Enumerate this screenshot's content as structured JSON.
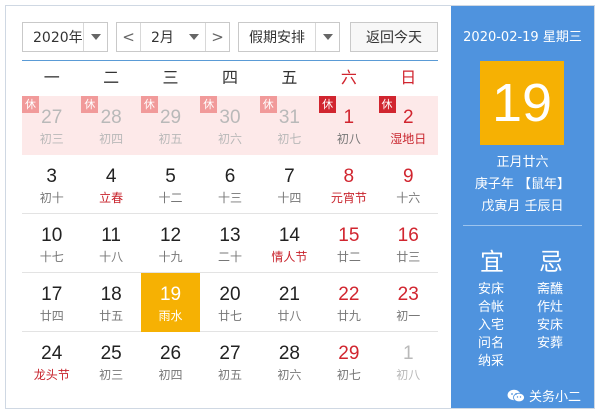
{
  "toolbar": {
    "year": "2020年",
    "month": "2月",
    "holiday": "假期安排",
    "today_button": "返回今天",
    "prev": "<",
    "next": ">"
  },
  "weekdays": [
    "一",
    "二",
    "三",
    "四",
    "五",
    "六",
    "日"
  ],
  "rest_tag": "休",
  "weeks": [
    [
      {
        "n": "27",
        "s": "初三",
        "dim": true,
        "rest": true
      },
      {
        "n": "28",
        "s": "初四",
        "dim": true,
        "rest": true
      },
      {
        "n": "29",
        "s": "初五",
        "dim": true,
        "rest": true
      },
      {
        "n": "30",
        "s": "初六",
        "dim": true,
        "rest": true
      },
      {
        "n": "31",
        "s": "初七",
        "dim": true,
        "rest": true
      },
      {
        "n": "1",
        "s": "初八",
        "rest": true,
        "weekend": true
      },
      {
        "n": "2",
        "s": "湿地日",
        "rest": true,
        "weekend": true,
        "red": true
      }
    ],
    [
      {
        "n": "3",
        "s": "初十"
      },
      {
        "n": "4",
        "s": "立春",
        "red": true
      },
      {
        "n": "5",
        "s": "十二"
      },
      {
        "n": "6",
        "s": "十三"
      },
      {
        "n": "7",
        "s": "十四"
      },
      {
        "n": "8",
        "s": "元宵节",
        "weekend": true,
        "red": true
      },
      {
        "n": "9",
        "s": "十六",
        "weekend": true
      }
    ],
    [
      {
        "n": "10",
        "s": "十七"
      },
      {
        "n": "11",
        "s": "十八"
      },
      {
        "n": "12",
        "s": "十九"
      },
      {
        "n": "13",
        "s": "二十"
      },
      {
        "n": "14",
        "s": "情人节",
        "red": true
      },
      {
        "n": "15",
        "s": "廿二",
        "weekend": true
      },
      {
        "n": "16",
        "s": "廿三",
        "weekend": true
      }
    ],
    [
      {
        "n": "17",
        "s": "廿四"
      },
      {
        "n": "18",
        "s": "廿五"
      },
      {
        "n": "19",
        "s": "雨水",
        "today": true
      },
      {
        "n": "20",
        "s": "廿七"
      },
      {
        "n": "21",
        "s": "廿八"
      },
      {
        "n": "22",
        "s": "廿九",
        "weekend": true
      },
      {
        "n": "23",
        "s": "初一",
        "weekend": true
      }
    ],
    [
      {
        "n": "24",
        "s": "龙头节",
        "red": true
      },
      {
        "n": "25",
        "s": "初三"
      },
      {
        "n": "26",
        "s": "初四"
      },
      {
        "n": "27",
        "s": "初五"
      },
      {
        "n": "28",
        "s": "初六"
      },
      {
        "n": "29",
        "s": "初七",
        "weekend": true
      },
      {
        "n": "1",
        "s": "初八",
        "weekend": true,
        "dim": true
      }
    ]
  ],
  "side": {
    "date_line": "2020-02-19 星期三",
    "big_day": "19",
    "lunar_date": "正月廿六",
    "year_ganzhi": "庚子年 【鼠年】",
    "month_day_ganzhi": "戊寅月 壬辰日",
    "yi_title": "宜",
    "ji_title": "忌",
    "yi": [
      "安床",
      "合帐",
      "入宅",
      "问名",
      "纳采"
    ],
    "ji": [
      "斋醮",
      "作灶",
      "安床",
      "安葬"
    ],
    "wechat": "关务小二"
  },
  "colors": {
    "side_bg": "#4f93de",
    "today_bg": "#f6b103",
    "holiday_bg": "#fde9e9",
    "red": "#d1252f"
  }
}
